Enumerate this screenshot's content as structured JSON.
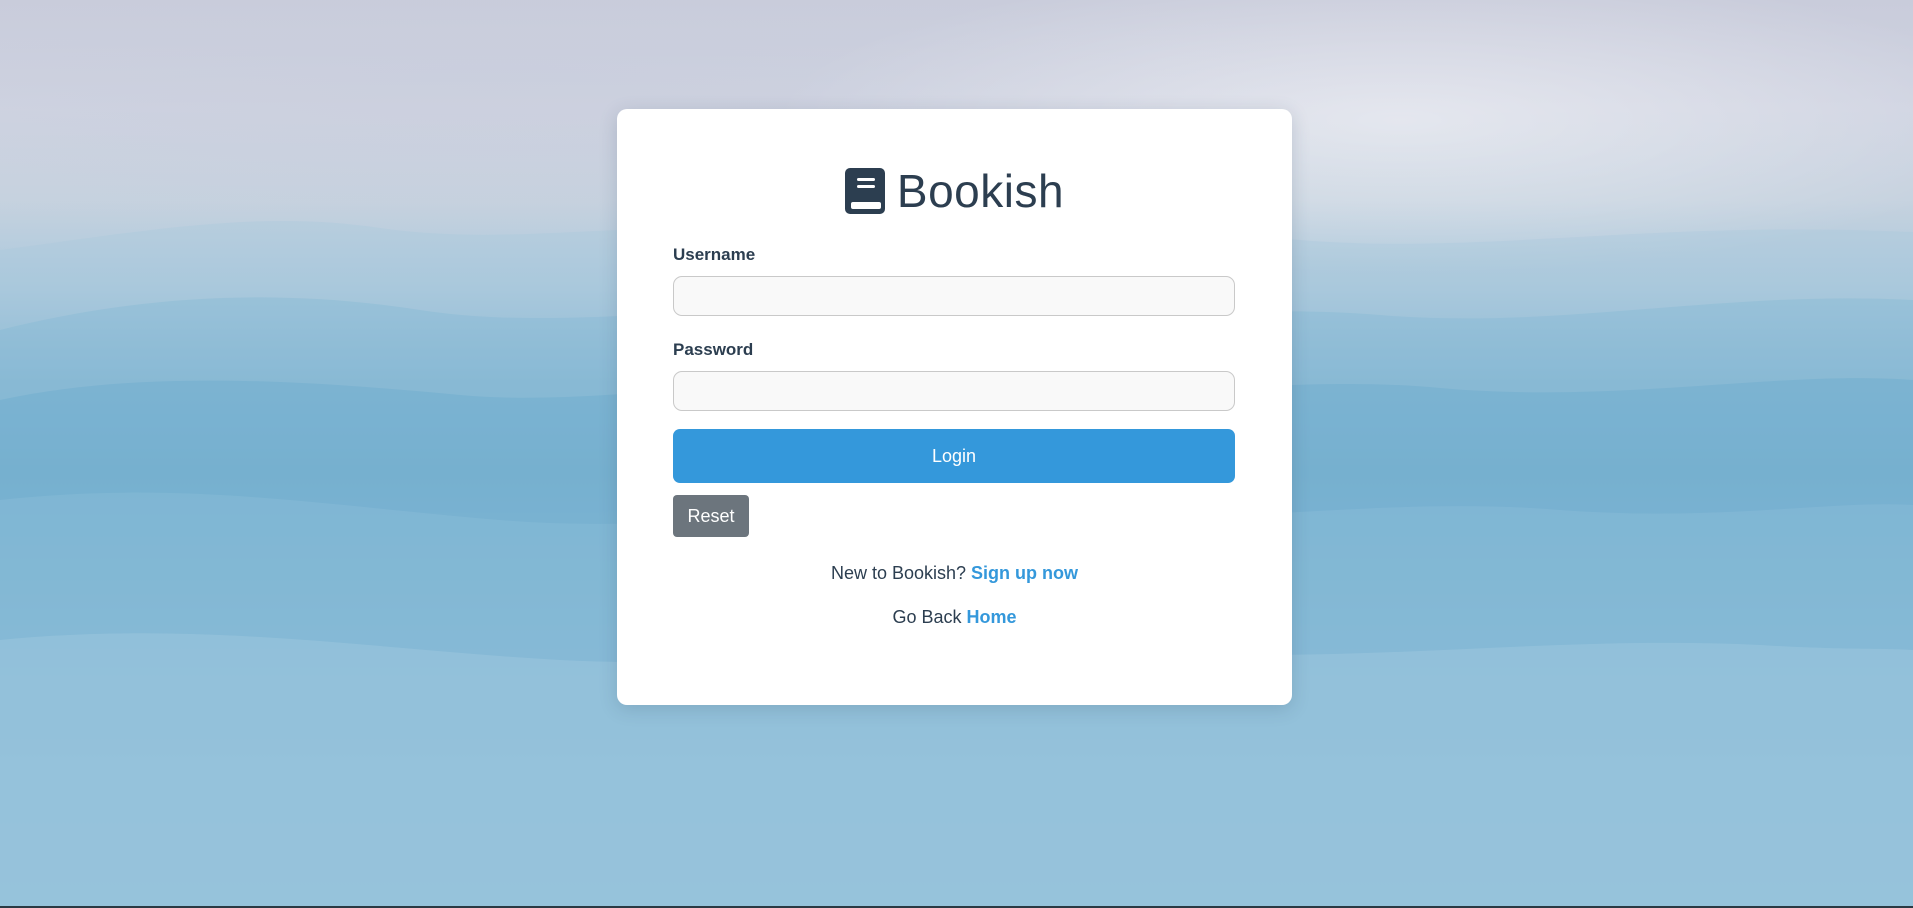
{
  "brand": {
    "title": "Bookish",
    "icon": "book-icon"
  },
  "form": {
    "username_label": "Username",
    "username_value": "",
    "password_label": "Password",
    "password_value": "",
    "login_label": "Login",
    "reset_label": "Reset"
  },
  "signup": {
    "prompt": "New to Bookish?",
    "link_label": "Sign up now"
  },
  "home": {
    "prompt": "Go Back",
    "link_label": "Home"
  },
  "colors": {
    "accent": "#3498db",
    "text": "#2c3e50",
    "reset_button": "#6c757d"
  }
}
